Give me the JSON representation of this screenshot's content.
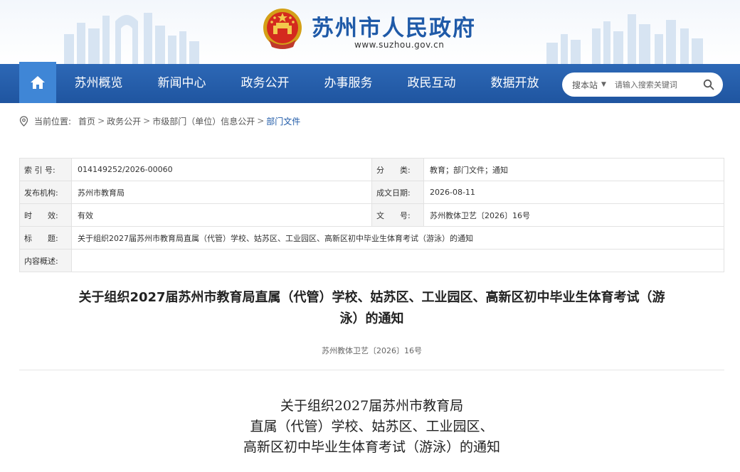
{
  "header": {
    "site_title": "苏州市人民政府",
    "site_domain": "www.suzhou.gov.cn",
    "emblem_icon": "national-emblem-icon"
  },
  "nav": {
    "home_icon": "home-icon",
    "items": [
      "苏州概览",
      "新闻中心",
      "政务公开",
      "办事服务",
      "政民互动",
      "数据开放"
    ],
    "search": {
      "scope": "搜本站",
      "placeholder": "请输入搜索关键词",
      "button_icon": "search-icon"
    }
  },
  "breadcrumb": {
    "prefix": "当前位置:",
    "items": [
      "首页",
      "政务公开",
      "市级部门（单位）信息公开",
      "部门文件"
    ],
    "separator": ">"
  },
  "info": {
    "index_label": "索 引 号:",
    "index_value": "014149252/2026-00060",
    "category_label": "分　　类:",
    "category_value": "教育；部门文件；通知",
    "publisher_label": "发布机构:",
    "publisher_value": "苏州市教育局",
    "date_label": "成文日期:",
    "date_value": "2026-08-11",
    "validity_label": "时　　效:",
    "validity_value": "有效",
    "docno_label": "文　　号:",
    "docno_value": "苏州教体卫艺〔2026〕16号",
    "title_label": "标　　题:",
    "title_value": "关于组织2027届苏州市教育局直属（代管）学校、姑苏区、工业园区、高新区初中毕业生体育考试（游泳）的通知",
    "summary_label": "内容概述:",
    "summary_value": ""
  },
  "article": {
    "title_line1": "关于组织2027届苏州市教育局直属（代管）学校、姑苏区、工业园区、高新区初中毕业生体育考试（游",
    "title_line2": "泳）的通知",
    "doc_number": "苏州教体卫艺〔2026〕16号",
    "heading_lines": [
      "关于组织2027届苏州市教育局",
      "直属（代管）学校、姑苏区、工业园区、",
      "高新区初中毕业生体育考试（游泳）的通知"
    ]
  },
  "colors": {
    "brand_blue": "#1f5aa8",
    "nav_blue": "#2a62b0",
    "home_tile": "#3f86d6"
  }
}
